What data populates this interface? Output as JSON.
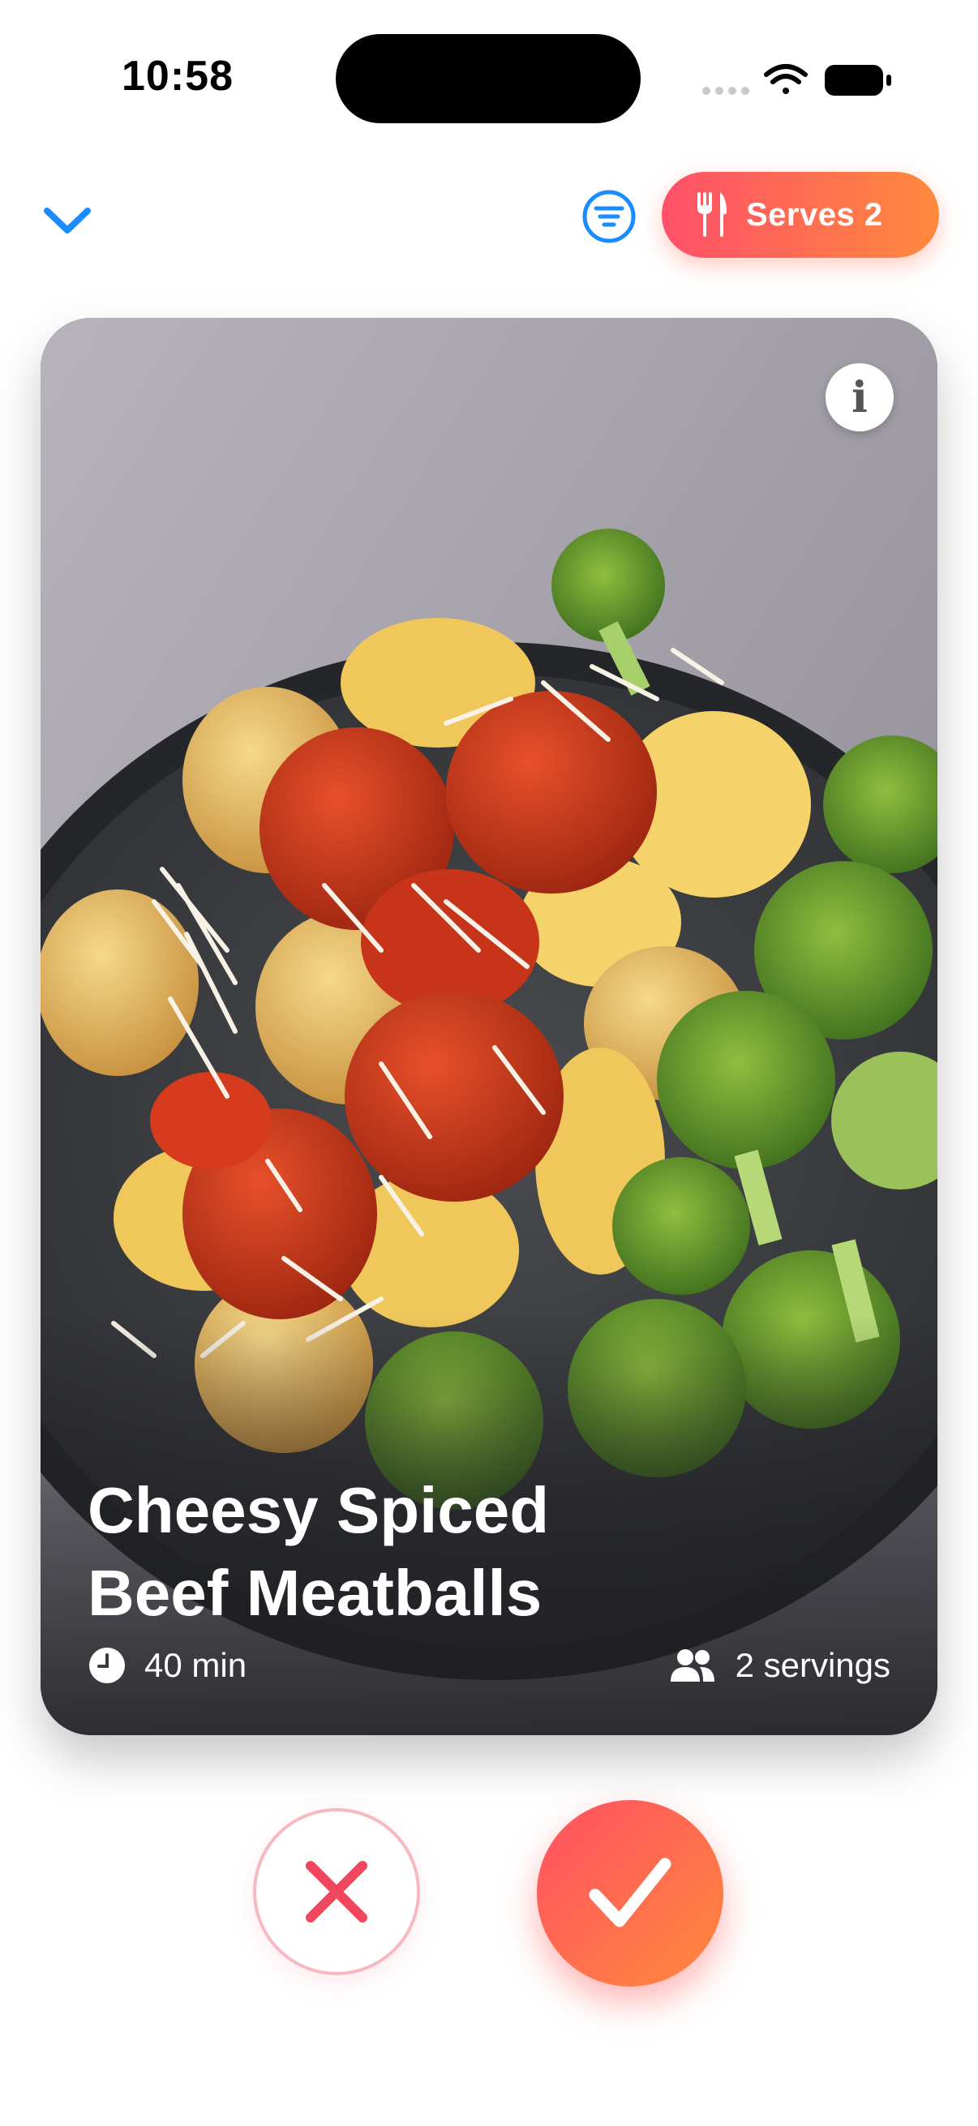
{
  "status_bar": {
    "time": "10:58"
  },
  "toolbar": {
    "collapse_icon": "chevron-down-icon",
    "filter_icon": "filter-icon",
    "serves_label": "Serves 2",
    "serves_icon": "fork-knife-icon",
    "accent_color": "#1a8cff"
  },
  "card": {
    "title_line1": "Cheesy Spiced",
    "title_line2": "Beef Meatballs",
    "time": "40 min",
    "servings": "2 servings",
    "info_symbol": "i"
  },
  "actions": {
    "reject_icon": "close-icon",
    "accept_icon": "checkmark-icon",
    "brand_gradient": [
      "#ff4f63",
      "#ff8a3c"
    ]
  }
}
